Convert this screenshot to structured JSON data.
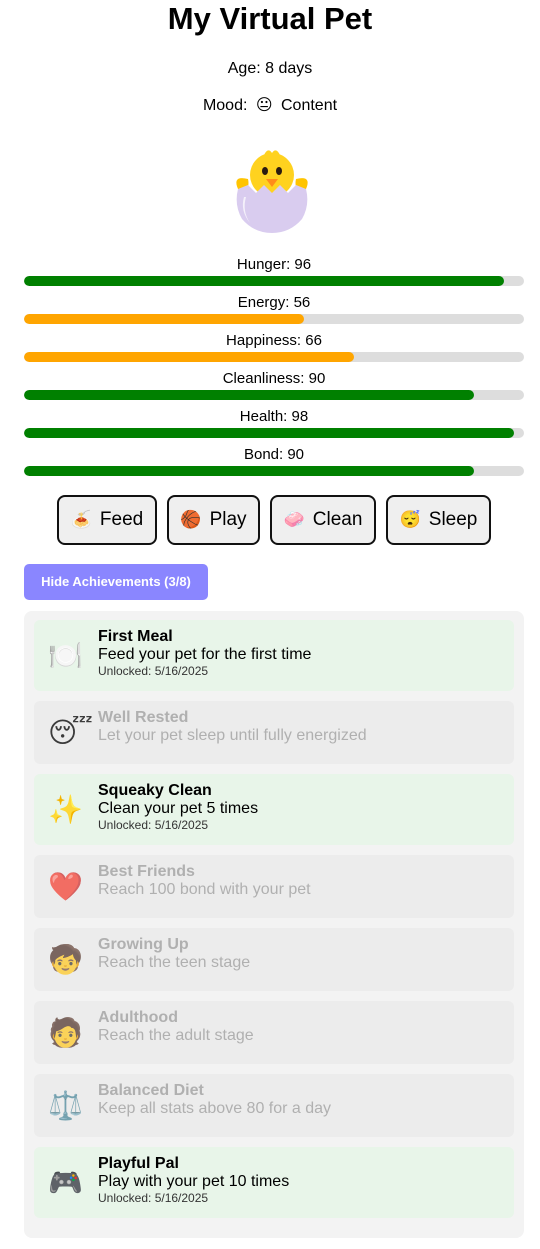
{
  "title": "My Virtual Pet",
  "age_text": "Age: 8 days",
  "mood": {
    "label": "Mood:",
    "emoji": "😐",
    "value": "Content"
  },
  "pet": {
    "icon": "hatching-chick-icon"
  },
  "colors": {
    "good": "#008000",
    "medium": "#ffa500",
    "track": "#dddddd",
    "accent": "#8a86ff"
  },
  "stats": [
    {
      "name": "Hunger",
      "label": "Hunger: 96",
      "value": 96,
      "color": "#008000"
    },
    {
      "name": "Energy",
      "label": "Energy: 56",
      "value": 56,
      "color": "#ffa500"
    },
    {
      "name": "Happiness",
      "label": "Happiness: 66",
      "value": 66,
      "color": "#ffa500"
    },
    {
      "name": "Cleanliness",
      "label": "Cleanliness: 90",
      "value": 90,
      "color": "#008000"
    },
    {
      "name": "Health",
      "label": "Health: 98",
      "value": 98,
      "color": "#008000"
    },
    {
      "name": "Bond",
      "label": "Bond: 90",
      "value": 90,
      "color": "#008000"
    }
  ],
  "actions": [
    {
      "label": "Feed",
      "emoji": "🍝"
    },
    {
      "label": "Play",
      "emoji": "🏀"
    },
    {
      "label": "Clean",
      "emoji": "🧼"
    },
    {
      "label": "Sleep",
      "emoji": "😴"
    }
  ],
  "achievements_toggle": "Hide Achievements (3/8)",
  "achievements": [
    {
      "name": "First Meal",
      "desc": "Feed your pet for the first time",
      "unlocked": true,
      "date": "Unlocked: 5/16/2025",
      "emoji": "🍽️",
      "icon": "plate-icon"
    },
    {
      "name": "Well Rested",
      "desc": "Let your pet sleep until fully energized",
      "unlocked": false,
      "emoji": "😴",
      "icon": "sleeping-face-icon"
    },
    {
      "name": "Squeaky Clean",
      "desc": "Clean your pet 5 times",
      "unlocked": true,
      "date": "Unlocked: 5/16/2025",
      "emoji": "✨",
      "icon": "sparkles-icon"
    },
    {
      "name": "Best Friends",
      "desc": "Reach 100 bond with your pet",
      "unlocked": false,
      "emoji": "❤️",
      "icon": "heart-icon"
    },
    {
      "name": "Growing Up",
      "desc": "Reach the teen stage",
      "unlocked": false,
      "emoji": "🧒",
      "icon": "child-icon"
    },
    {
      "name": "Adulthood",
      "desc": "Reach the adult stage",
      "unlocked": false,
      "emoji": "🧑",
      "icon": "adult-icon"
    },
    {
      "name": "Balanced Diet",
      "desc": "Keep all stats above 80 for a day",
      "unlocked": false,
      "emoji": "⚖️",
      "icon": "balance-scale-icon"
    },
    {
      "name": "Playful Pal",
      "desc": "Play with your pet 10 times",
      "unlocked": true,
      "date": "Unlocked: 5/16/2025",
      "emoji": "🎮",
      "icon": "game-controller-icon"
    }
  ]
}
